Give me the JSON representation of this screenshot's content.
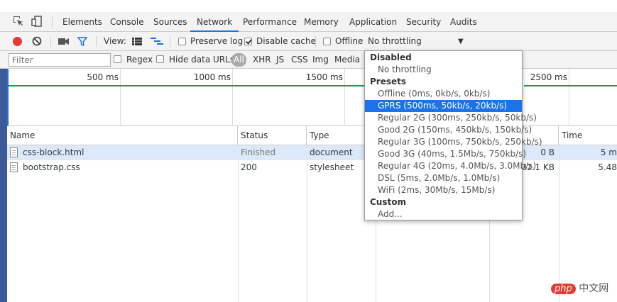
{
  "tabs": [
    {
      "label": "Elements"
    },
    {
      "label": "Console"
    },
    {
      "label": "Sources"
    },
    {
      "label": "Network",
      "active": true
    },
    {
      "label": "Performance"
    },
    {
      "label": "Memory"
    },
    {
      "label": "Application"
    },
    {
      "label": "Security"
    },
    {
      "label": "Audits"
    }
  ],
  "toolbar": {
    "record_icon": "record-icon",
    "clear_icon": "clear-icon",
    "capture_icon": "camera-icon",
    "filter_icon": "filter-icon",
    "view_label": "View:",
    "preserve_log": "Preserve log",
    "preserve_log_checked": false,
    "disable_cache": "Disable cache",
    "disable_cache_checked": true,
    "offline": "Offline",
    "offline_checked": false,
    "throttling_value": "No throttling",
    "accent_record": "#e53935"
  },
  "filterbar": {
    "placeholder": "Filter",
    "regex": "Regex",
    "hide_data_urls": "Hide data URLs",
    "types": [
      "All",
      "XHR",
      "JS",
      "CSS",
      "Img",
      "Media"
    ]
  },
  "overview": {
    "ticks": [
      "500 ms",
      "1000 ms",
      "1500 ms",
      "2500 ms"
    ]
  },
  "grid": {
    "columns": [
      "Name",
      "Status",
      "Type",
      "Time"
    ],
    "rows": [
      {
        "name": "css-block.html",
        "status": "Finished",
        "type": "document",
        "size": "0 B",
        "time": "5 m"
      },
      {
        "name": "bootstrap.css",
        "status": "200",
        "type": "stylesheet",
        "size": "32.1 KB",
        "time": "5.48"
      }
    ]
  },
  "dropdown": {
    "items": [
      {
        "label": "Disabled",
        "kind": "header"
      },
      {
        "label": "No throttling",
        "kind": "option"
      },
      {
        "label": "Presets",
        "kind": "header"
      },
      {
        "label": "Offline (0ms, 0kb/s, 0kb/s)",
        "kind": "option"
      },
      {
        "label": "GPRS (500ms, 50kb/s, 20kb/s)",
        "kind": "option",
        "selected": true
      },
      {
        "label": "Regular 2G (300ms, 250kb/s, 50kb/s)",
        "kind": "option"
      },
      {
        "label": "Good 2G (150ms, 450kb/s, 150kb/s)",
        "kind": "option"
      },
      {
        "label": "Regular 3G (100ms, 750kb/s, 250kb/s)",
        "kind": "option"
      },
      {
        "label": "Good 3G (40ms, 1.5Mb/s, 750kb/s)",
        "kind": "option"
      },
      {
        "label": "Regular 4G (20ms, 4.0Mb/s, 3.0Mb/s)",
        "kind": "option"
      },
      {
        "label": "DSL (5ms, 2.0Mb/s, 1.0Mb/s)",
        "kind": "option"
      },
      {
        "label": "WiFi (2ms, 30Mb/s, 15Mb/s)",
        "kind": "option"
      },
      {
        "label": "Custom",
        "kind": "header"
      },
      {
        "label": "Add...",
        "kind": "option"
      }
    ],
    "selected_color": "#1a73e8"
  },
  "watermark": {
    "logo": "php",
    "text": "中文网"
  }
}
